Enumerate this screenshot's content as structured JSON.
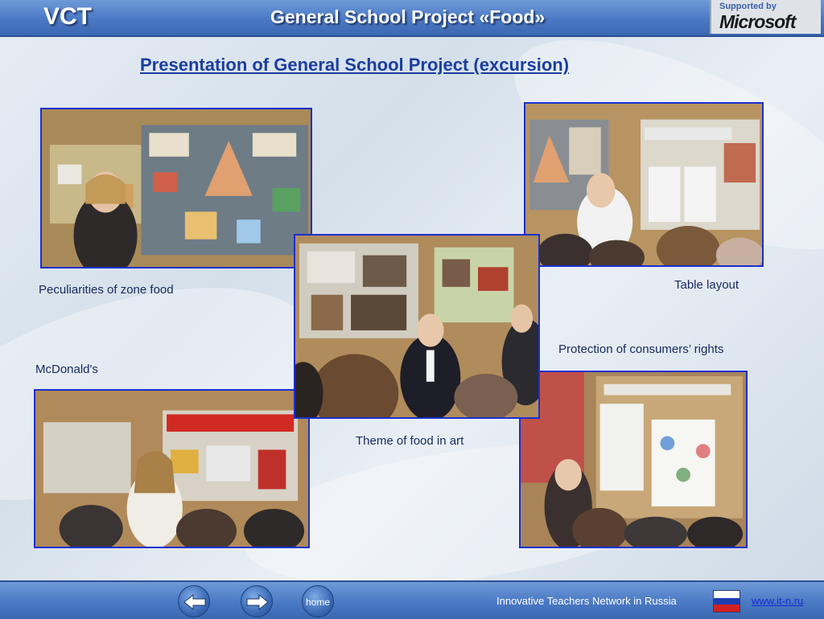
{
  "header": {
    "logo_text": "VCT",
    "title": "General School Project «Food»",
    "sponsor_supported": "Supported by",
    "sponsor_name": "Microsoft"
  },
  "slide": {
    "subtitle": "Presentation of General School Project (excursion)",
    "captions": {
      "zone_food": "Peculiarities of zone food",
      "table_layout": "Table layout",
      "consumers_rights": "Protection of consumers’ rights",
      "mcdonalds": "McDonald's",
      "food_in_art": "Theme of food in art"
    }
  },
  "footer": {
    "home_label": "home",
    "network_text": "Innovative Teachers Network in Russia",
    "site_link": "www.it-n.ru"
  },
  "colors": {
    "header_blue": "#4a79c4",
    "subtitle_blue": "#1a3ea0",
    "photo_border": "#1a2fd0"
  }
}
